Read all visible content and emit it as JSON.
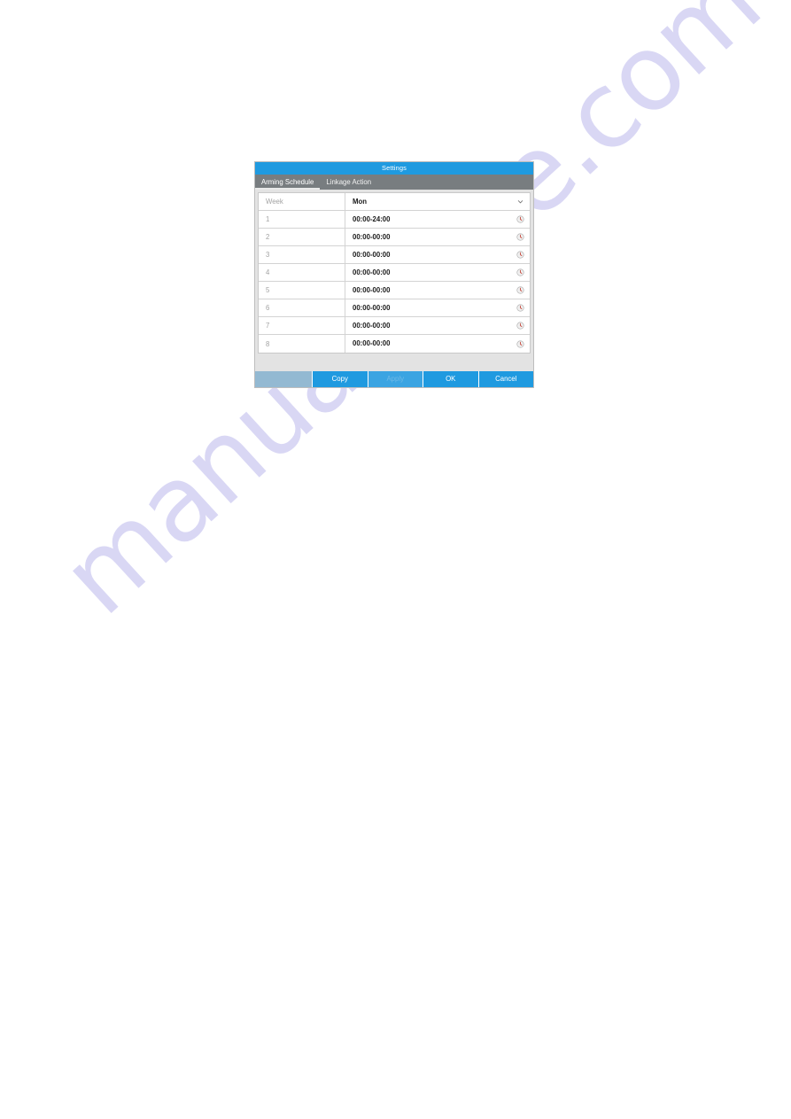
{
  "watermark": {
    "text": "manualshive.com"
  },
  "dialog": {
    "title": "Settings",
    "tabs": [
      {
        "label": "Arming Schedule",
        "active": true
      },
      {
        "label": "Linkage Action",
        "active": false
      }
    ],
    "week_row": {
      "label": "Week",
      "value": "Mon",
      "chevron_icon": "chevron-down-icon"
    },
    "schedule_rows": [
      {
        "label": "1",
        "value": "00:00-24:00",
        "icon": "clock-icon"
      },
      {
        "label": "2",
        "value": "00:00-00:00",
        "icon": "clock-icon"
      },
      {
        "label": "3",
        "value": "00:00-00:00",
        "icon": "clock-icon"
      },
      {
        "label": "4",
        "value": "00:00-00:00",
        "icon": "clock-icon"
      },
      {
        "label": "5",
        "value": "00:00-00:00",
        "icon": "clock-icon"
      },
      {
        "label": "6",
        "value": "00:00-00:00",
        "icon": "clock-icon"
      },
      {
        "label": "7",
        "value": "00:00-00:00",
        "icon": "clock-icon"
      },
      {
        "label": "8",
        "value": "00:00-00:00",
        "icon": "clock-icon"
      }
    ],
    "buttons": [
      {
        "label": "Copy",
        "disabled": false
      },
      {
        "label": "Apply",
        "disabled": true
      },
      {
        "label": "OK",
        "disabled": false
      },
      {
        "label": "Cancel",
        "disabled": false
      }
    ],
    "colors": {
      "title_bar": "#1f9ae0",
      "tab_bar": "#787d80",
      "button": "#1f9ae0",
      "button_disabled": "#3ba4e2",
      "body": "#e3e3e3",
      "watermark": "#cfcdf2"
    }
  }
}
